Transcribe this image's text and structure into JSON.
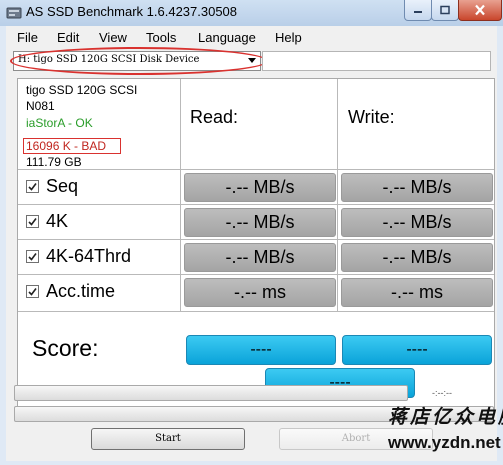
{
  "window": {
    "title": "AS SSD Benchmark 1.6.4237.30508",
    "app_icon": "as-ssd-app-icon"
  },
  "menu": [
    "File",
    "Edit",
    "View",
    "Tools",
    "Language",
    "Help"
  ],
  "drive_select": {
    "selected": "H: tigo SSD 120G SCSI Disk Device"
  },
  "drive_info": {
    "model": "tigo SSD 120G SCSI",
    "firmware": "N081",
    "driver": "iaStorA - OK",
    "alignment": "16096 K - BAD",
    "capacity": "111.79 GB"
  },
  "colors": {
    "ok": "#2a9d2a",
    "bad": "#c0261f",
    "score": "#12b0e6",
    "highlight": "#d9322f"
  },
  "columns": {
    "read": "Read:",
    "write": "Write:"
  },
  "tests": [
    {
      "label": "Seq",
      "checked": true,
      "read": "-.-- MB/s",
      "write": "-.-- MB/s"
    },
    {
      "label": "4K",
      "checked": true,
      "read": "-.-- MB/s",
      "write": "-.-- MB/s"
    },
    {
      "label": "4K-64Thrd",
      "checked": true,
      "read": "-.-- MB/s",
      "write": "-.-- MB/s"
    },
    {
      "label": "Acc.time",
      "checked": true,
      "read": "-.-- ms",
      "write": "-.-- ms"
    }
  ],
  "score": {
    "label": "Score:",
    "read": "----",
    "write": "----",
    "total": "----"
  },
  "progress": {
    "time": "-:--:--",
    "value": 0
  },
  "buttons": {
    "start": "Start",
    "abort": "Abort"
  },
  "watermark": {
    "chinese": "蒋店亿众电脑",
    "url": "www.yzdn.net"
  }
}
